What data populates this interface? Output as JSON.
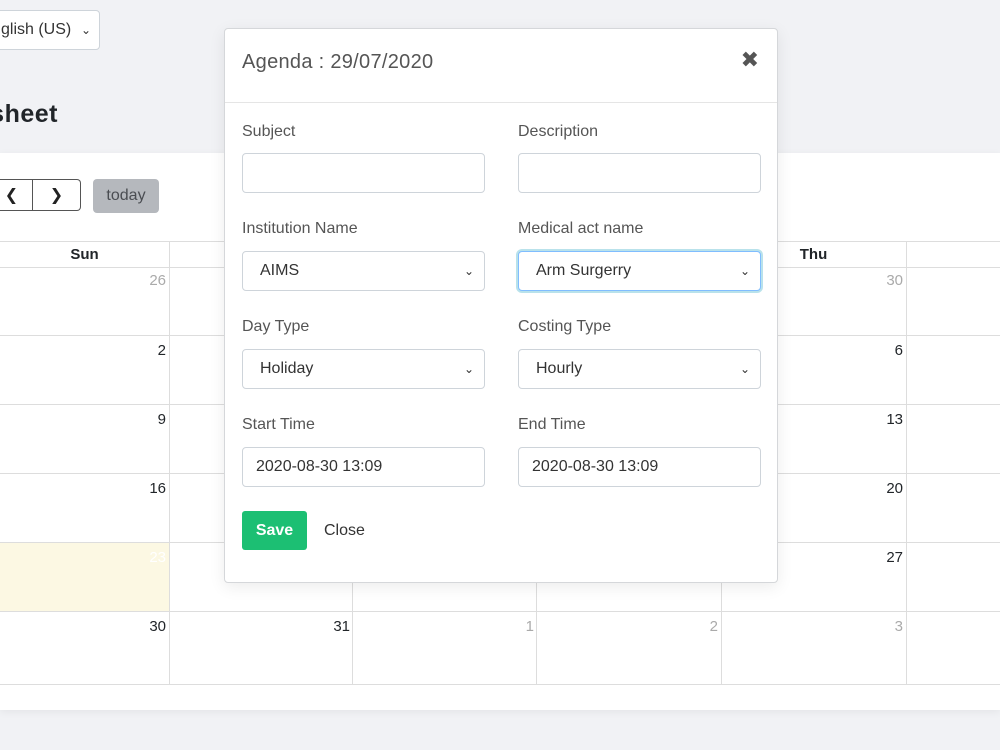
{
  "language": {
    "selected": "English (US)",
    "visible": "glish (US)",
    "icon": "chevron-down-icon"
  },
  "page": {
    "title": "Timesheet",
    "visible_title": "nesheet"
  },
  "calendar": {
    "today_label": "today",
    "prev_icon": "chevron-left-icon",
    "next_icon": "chevron-right-icon",
    "headers": [
      "Sun",
      "Thu"
    ],
    "weeks": [
      [
        "26",
        "",
        "",
        "",
        "30"
      ],
      [
        "2",
        "",
        "",
        "",
        "6"
      ],
      [
        "9",
        "",
        "",
        "",
        "13"
      ],
      [
        "16",
        "",
        "",
        "",
        "20"
      ],
      [
        "23",
        "",
        "",
        "",
        "27"
      ],
      [
        "30",
        "31",
        "1",
        "2",
        "3"
      ]
    ]
  },
  "modal": {
    "title": "Agenda : 29/07/2020",
    "close_icon": "close-icon",
    "subject_label": "Subject",
    "subject_value": "",
    "description_label": "Description",
    "description_value": "",
    "institution_label": "Institution Name",
    "institution_value": "AIMS",
    "medical_label": "Medical act name",
    "medical_value": "Arm Surgerry",
    "daytype_label": "Day Type",
    "daytype_value": "Holiday",
    "costing_label": "Costing Type",
    "costing_value": "Hourly",
    "start_label": "Start Time",
    "start_value": "2020-08-30 13:09",
    "end_label": "End Time",
    "end_value": "2020-08-30 13:09",
    "save_label": "Save",
    "close_label": "Close"
  }
}
